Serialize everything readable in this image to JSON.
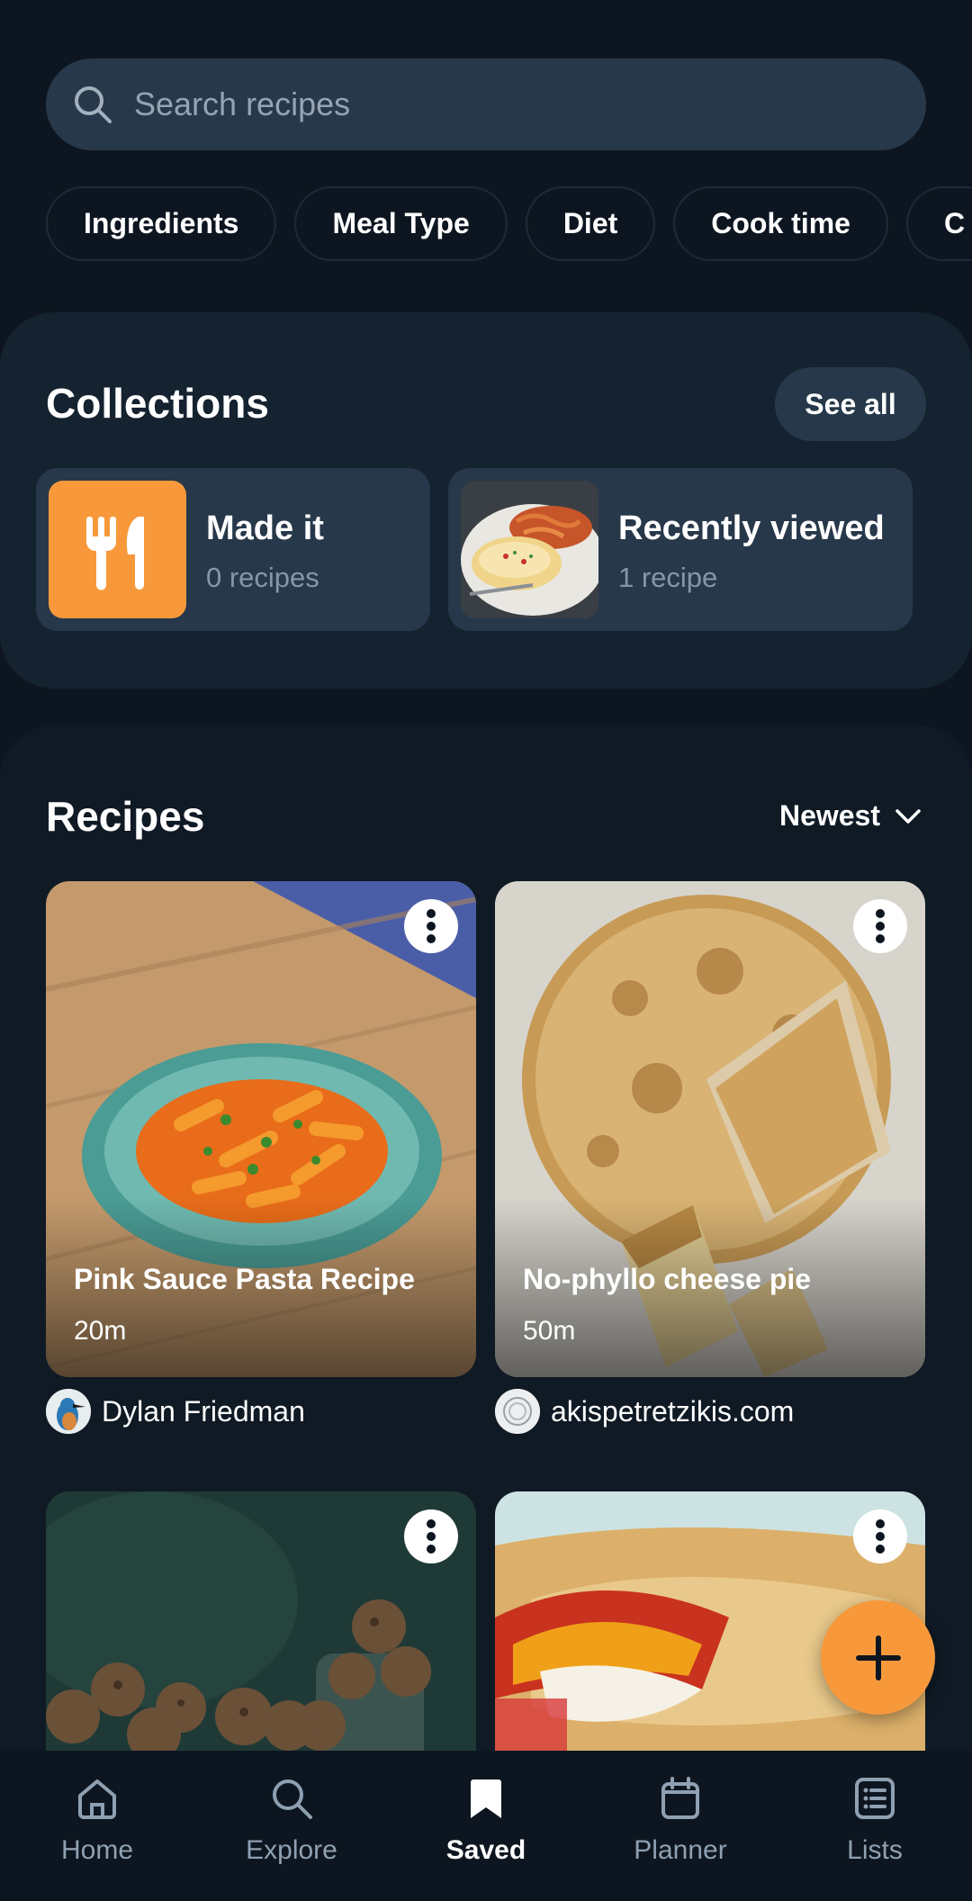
{
  "search": {
    "placeholder": "Search recipes"
  },
  "filters": [
    "Ingredients",
    "Meal Type",
    "Diet",
    "Cook time",
    "C"
  ],
  "collections": {
    "title": "Collections",
    "see_all_label": "See all",
    "items": [
      {
        "name": "Made it",
        "count": "0 recipes",
        "icon": "utensils-icon"
      },
      {
        "name": "Recently viewed",
        "count": "1 recipe"
      }
    ]
  },
  "recipes": {
    "title": "Recipes",
    "sort_label": "Newest",
    "items": [
      {
        "title": "Pink Sauce Pasta Recipe",
        "time": "20m",
        "author": "Dylan Friedman"
      },
      {
        "title": "No-phyllo cheese pie",
        "time": "50m",
        "author": "akispetretzikis.com"
      },
      {
        "title": "",
        "time": "",
        "author": ""
      },
      {
        "title": "",
        "time": "",
        "author": ""
      }
    ]
  },
  "nav": {
    "items": [
      {
        "label": "Home",
        "icon": "home-icon"
      },
      {
        "label": "Explore",
        "icon": "search-icon"
      },
      {
        "label": "Saved",
        "icon": "bookmark-icon",
        "active": true
      },
      {
        "label": "Planner",
        "icon": "calendar-icon"
      },
      {
        "label": "Lists",
        "icon": "list-icon"
      }
    ]
  },
  "colors": {
    "background": "#0d1620",
    "surface": "#27384a",
    "accent": "#f7993b"
  }
}
